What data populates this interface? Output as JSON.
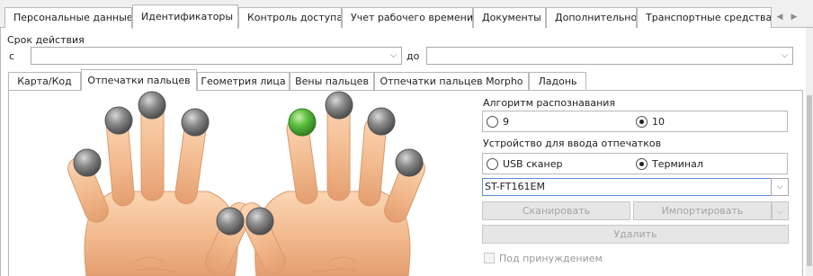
{
  "top_tabs": [
    {
      "label": "Персональные данные",
      "active": false
    },
    {
      "label": "Идентификаторы",
      "active": true
    },
    {
      "label": "Контроль доступа",
      "active": false
    },
    {
      "label": "Учет рабочего времени",
      "active": false
    },
    {
      "label": "Документы",
      "active": false
    },
    {
      "label": "Дополнительно",
      "active": false
    },
    {
      "label": "Транспортные средства",
      "active": false
    }
  ],
  "validity": {
    "title": "Срок действия",
    "from_label": "с",
    "to_label": "до",
    "from_value": "",
    "to_value": ""
  },
  "inner_tabs": [
    {
      "label": "Карта/Код",
      "active": false
    },
    {
      "label": "Отпечатки пальцев",
      "active": true
    },
    {
      "label": "Геометрия лица",
      "active": false
    },
    {
      "label": "Вены пальцев",
      "active": false
    },
    {
      "label": "Отпечатки пальцев Morpho",
      "active": false
    },
    {
      "label": "Ладонь",
      "active": false
    }
  ],
  "fingers": {
    "enrolled_color": "#5cbf3f",
    "empty_color": "#8a8a8a",
    "right_index_enrolled": true
  },
  "algorithm": {
    "title": "Алгоритм распознавания",
    "options": [
      "9",
      "10"
    ],
    "selected": "10"
  },
  "device": {
    "title": "Устройство для ввода отпечатков",
    "options": [
      "USB сканер",
      "Терминал"
    ],
    "selected": "Терминал",
    "terminal_value": "ST-FT161EM"
  },
  "buttons": {
    "scan": "Сканировать",
    "import": "Импортировать",
    "delete": "Удалить"
  },
  "duress": {
    "label": "Под принуждением",
    "checked": false
  }
}
